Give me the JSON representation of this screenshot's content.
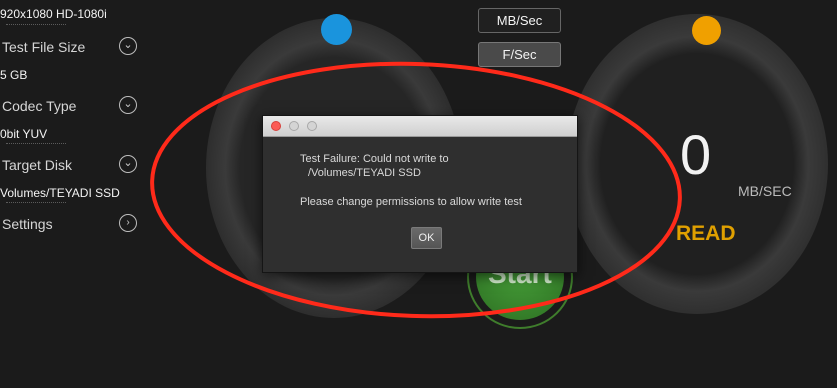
{
  "sidebar": {
    "resolution": "920x1080 HD-1080i",
    "items": [
      {
        "label": "Test File Size",
        "value": "5 GB",
        "icon": "chevron-down-icon"
      },
      {
        "label": "Codec Type",
        "value": "0bit YUV",
        "icon": "chevron-down-icon"
      },
      {
        "label": "Target Disk",
        "value": "Volumes/TEYADI SSD",
        "icon": "chevron-down-icon"
      },
      {
        "label": "Settings",
        "icon": "chevron-right-icon"
      }
    ]
  },
  "units": {
    "mbs": "MB/Sec",
    "fs": "F/Sec"
  },
  "read_gauge": {
    "value": "0",
    "unit": "MB/SEC",
    "label": "READ"
  },
  "start": {
    "label": "Start"
  },
  "dialog": {
    "line1": "Test Failure: Could not write to",
    "line2": "/Volumes/TEYADI SSD",
    "line3": "Please change permissions to allow write test",
    "ok": "OK"
  },
  "colors": {
    "write_dot": "#1a94dd",
    "read_dot": "#f0a000",
    "read_label": "#e0a000",
    "start_button": "#3c8a2f",
    "annotation": "#ff2a1a"
  }
}
